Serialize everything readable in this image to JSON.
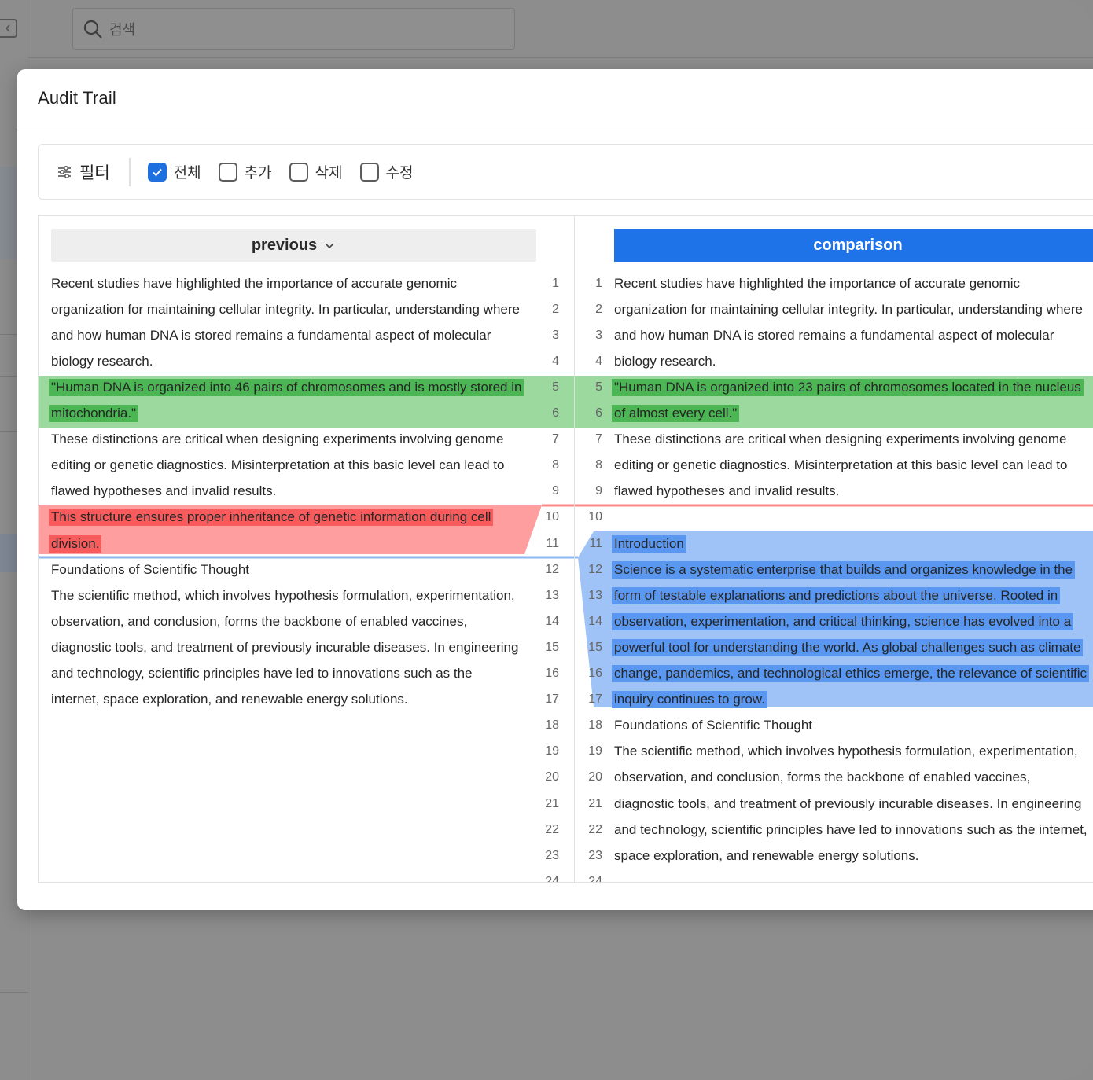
{
  "background": {
    "search_placeholder": "검색"
  },
  "modal": {
    "title": "Audit Trail",
    "filter": {
      "label": "필터",
      "options": [
        {
          "label": "전체",
          "checked": true
        },
        {
          "label": "추가",
          "checked": false
        },
        {
          "label": "삭제",
          "checked": false
        },
        {
          "label": "수정",
          "checked": false
        }
      ]
    },
    "left": {
      "header": "previous",
      "lines": [
        "Recent studies have highlighted the importance of accurate genomic",
        "organization for maintaining cellular integrity. In particular, understanding where",
        "and how human DNA is stored remains a fundamental aspect of molecular",
        "biology research.",
        "\"Human DNA is organized into 46 pairs of chromosomes and is mostly stored in",
        "mitochondria.\"",
        "These distinctions are critical when designing experiments involving genome",
        "editing or genetic diagnostics. Misinterpretation at this basic level can lead to",
        "flawed hypotheses and invalid results.",
        "This structure ensures proper inheritance of genetic information during cell",
        "division.",
        "Foundations of Scientific Thought",
        " The scientific method, which involves hypothesis formulation, experimentation,",
        "observation, and conclusion, forms the backbone of enabled vaccines,",
        "diagnostic tools, and treatment of previously incurable diseases. In engineering",
        "and technology, scientific principles have led to innovations such as the",
        "internet, space exploration, and renewable energy solutions."
      ],
      "numbers": [
        "1",
        "2",
        "3",
        "4",
        "5",
        "6",
        "7",
        "8",
        "9",
        "10",
        "11",
        "12",
        "13",
        "14",
        "15",
        "16",
        "17",
        "18",
        "19",
        "20",
        "21",
        "22",
        "23",
        "24"
      ]
    },
    "right": {
      "header": "comparison",
      "lines": [
        "Recent studies have highlighted the importance of accurate genomic",
        "organization for maintaining cellular integrity. In particular, understanding where",
        "and how human DNA is stored remains a fundamental aspect of molecular",
        "biology research.",
        "\"Human DNA is organized into 23 pairs of chromosomes located in the nucleus",
        "of almost every cell.\"",
        "These distinctions are critical when designing experiments involving genome",
        "editing or genetic diagnostics. Misinterpretation at this basic level can lead to",
        "flawed hypotheses and invalid results.",
        "",
        "Introduction",
        "Science is a systematic enterprise that builds and organizes knowledge in the",
        "form of testable explanations and predictions about the universe. Rooted in",
        "observation, experimentation, and critical thinking, science has evolved into a",
        "powerful tool for understanding the world. As global challenges such as climate",
        "change, pandemics, and technological ethics emerge, the relevance of scientific",
        "inquiry continues to grow.",
        "Foundations of Scientific Thought",
        " The scientific method, which involves hypothesis formulation, experimentation,",
        "observation, and conclusion, forms the backbone of enabled vaccines,",
        "diagnostic tools, and treatment of previously incurable diseases. In engineering",
        "and technology, scientific principles have led to innovations such as the internet,",
        "space exploration, and renewable energy solutions."
      ],
      "numbers": [
        "1",
        "2",
        "3",
        "4",
        "5",
        "6",
        "7",
        "8",
        "9",
        "10",
        "11",
        "12",
        "13",
        "14",
        "15",
        "16",
        "17",
        "18",
        "19",
        "20",
        "21",
        "22",
        "23",
        "24"
      ]
    },
    "colors": {
      "modified_band": "#9bd99e",
      "modified_text": "#4cb655",
      "deleted_band": "#ff9e9e",
      "deleted_text": "#f85b5b",
      "added_band": "#9fc3f7",
      "added_text": "#5a97f0",
      "accent": "#1f73e8"
    }
  }
}
